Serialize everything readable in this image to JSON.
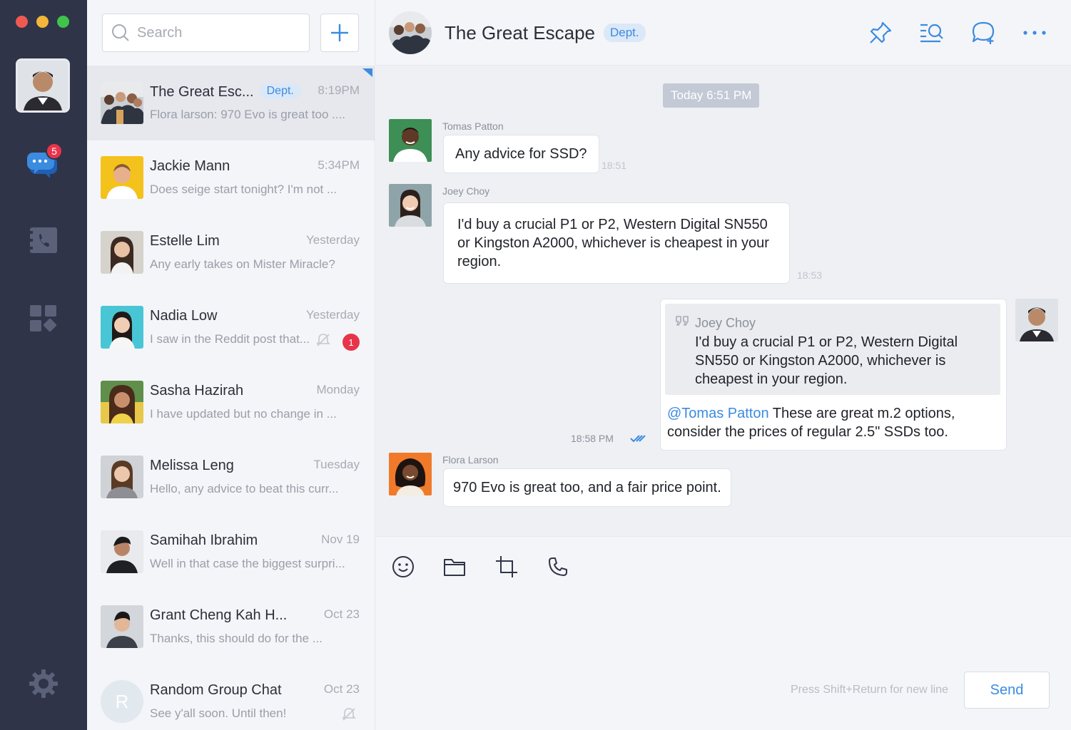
{
  "search": {
    "placeholder": "Search"
  },
  "rail": {
    "messages_badge": "5"
  },
  "chats": [
    {
      "name": "The Great Esc...",
      "tag": "Dept.",
      "time": "8:19PM",
      "preview": "Flora larson: 970 Evo is great too ....",
      "active": true
    },
    {
      "name": "Jackie Mann",
      "time": "5:34PM",
      "preview": "Does seige start tonight? I'm not ..."
    },
    {
      "name": "Estelle Lim",
      "time": "Yesterday",
      "preview": "Any early takes on Mister Miracle?"
    },
    {
      "name": "Nadia Low",
      "time": "Yesterday",
      "preview": "I saw in the Reddit post that...",
      "unread": "1",
      "muted": true
    },
    {
      "name": "Sasha Hazirah",
      "time": "Monday",
      "preview": "I have updated but no change in ..."
    },
    {
      "name": "Melissa Leng",
      "time": "Tuesday",
      "preview": "Hello, any advice to beat this curr..."
    },
    {
      "name": "Samihah Ibrahim",
      "time": "Nov 19",
      "preview": "Well in that case the biggest surpri..."
    },
    {
      "name": "Grant Cheng Kah H...",
      "time": "Oct 23",
      "preview": "Thanks, this should do for the ..."
    },
    {
      "name": "Random Group Chat",
      "time": "Oct 23",
      "preview": "See y'all soon. Until then!",
      "initial": "R",
      "muted": true
    }
  ],
  "header": {
    "title": "The Great Escape",
    "tag": "Dept."
  },
  "messages": {
    "date_separator": "Today  6:51 PM",
    "m1": {
      "sender": "Tomas Patton",
      "text": "Any advice for SSD?",
      "time": "18:51"
    },
    "m2": {
      "sender": "Joey Choy",
      "text": "I'd buy a crucial P1 or P2, Western Digital SN550 or Kingston A2000, whichever is cheapest in your region.",
      "time": "18:53"
    },
    "m3": {
      "quote_sender": "Joey Choy",
      "quote_text": "I'd buy a crucial P1 or P2, Western Digital SN550 or Kingston A2000, whichever is cheapest in your region.",
      "mention": "@Tomas Patton",
      "text": " These are great m.2 options, consider the prices of regular 2.5\" SSDs too.",
      "time": "18:58 PM"
    },
    "m4": {
      "sender": "Flora Larson",
      "text": "970 Evo is great too, and a fair price point."
    }
  },
  "composer": {
    "hint": "Press Shift+Return for new line",
    "send_label": "Send"
  },
  "colors": {
    "rail": "#2f3448",
    "accent": "#3b8be0",
    "badge": "#e8344a"
  }
}
